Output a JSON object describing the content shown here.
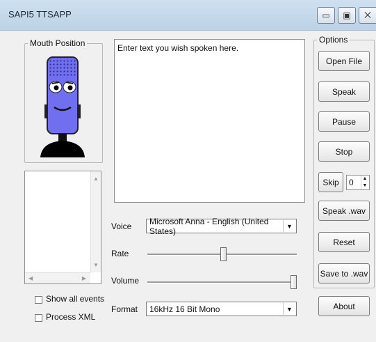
{
  "window": {
    "title": "SAPI5 TTSAPP",
    "minimize_glyph": "▭",
    "maximize_glyph": "▣",
    "close_glyph": "⨉"
  },
  "mouth_position": {
    "label": "Mouth Position"
  },
  "text_area": {
    "value": "Enter text you wish spoken here."
  },
  "voice": {
    "label": "Voice",
    "value": "Microsoft Anna - English (United States)"
  },
  "rate": {
    "label": "Rate",
    "level": 0.51
  },
  "volume": {
    "label": "Volume",
    "level": 1.0
  },
  "format": {
    "label": "Format",
    "value": "16kHz 16 Bit Mono"
  },
  "checkboxes": {
    "show_all_events": "Show all events",
    "process_xml": "Process XML"
  },
  "options": {
    "label": "Options",
    "open_file": "Open File",
    "speak": "Speak",
    "pause": "Pause",
    "stop": "Stop",
    "skip": "Skip",
    "skip_value": "0",
    "speak_wav": "Speak .wav",
    "reset": "Reset",
    "save_to_wav": "Save to .wav"
  },
  "about": "About",
  "colors": {
    "mic_body": "#6f6ff0",
    "mic_base": "#000000",
    "titlebar": "#c6daed"
  }
}
